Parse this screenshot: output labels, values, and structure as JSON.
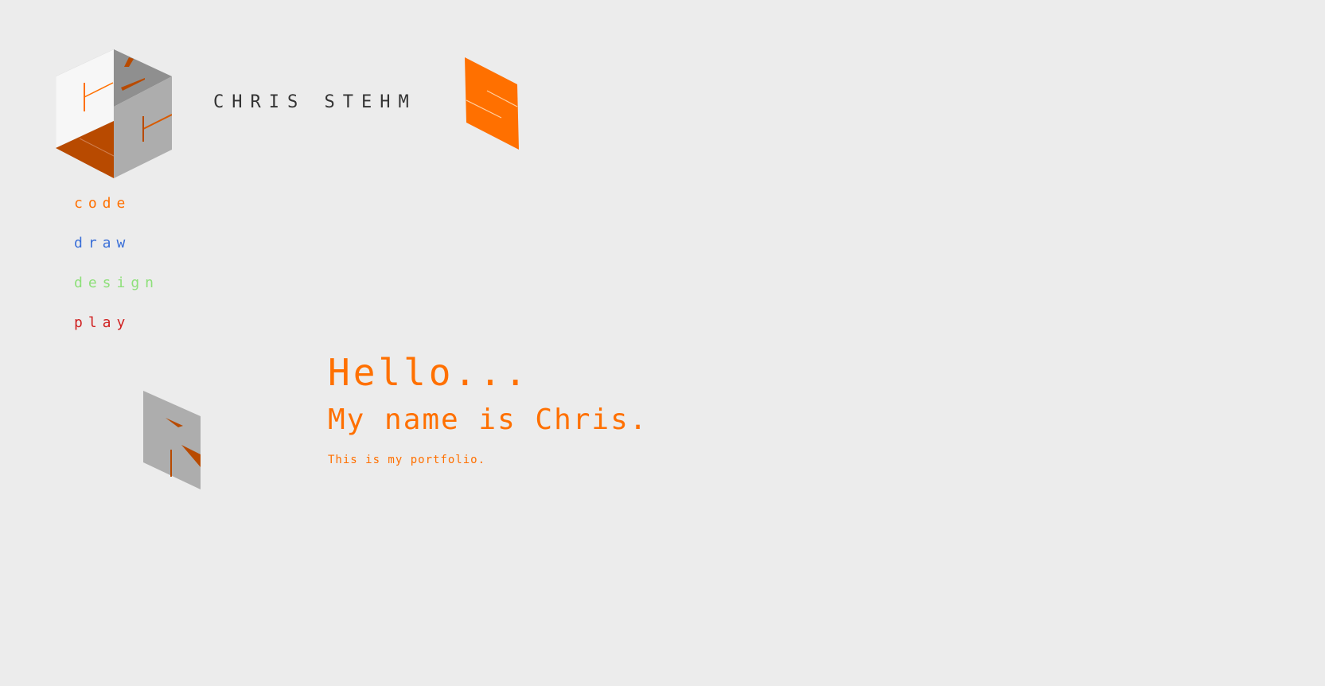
{
  "header": {
    "title": "CHRIS STEHM"
  },
  "nav": {
    "items": [
      {
        "label": "code",
        "color": "#ff7000"
      },
      {
        "label": "draw",
        "color": "#3a6fd8"
      },
      {
        "label": "design",
        "color": "#8ee07a"
      },
      {
        "label": "play",
        "color": "#d02020"
      }
    ]
  },
  "hero": {
    "greeting": "Hello...",
    "name_line": "My name is Chris.",
    "tagline": "This is my portfolio.",
    "color": "#ff7000"
  },
  "colors": {
    "accent": "#ff7000",
    "dark_orange": "#b84a00",
    "gray_light": "#aaaaaa",
    "gray_dark": "#8f8f8f",
    "background": "#ececec"
  },
  "icons": {
    "logo": "isometric-cube-logo",
    "panel_orange": "orange-s-panel",
    "panel_gray": "gray-r-panel"
  }
}
